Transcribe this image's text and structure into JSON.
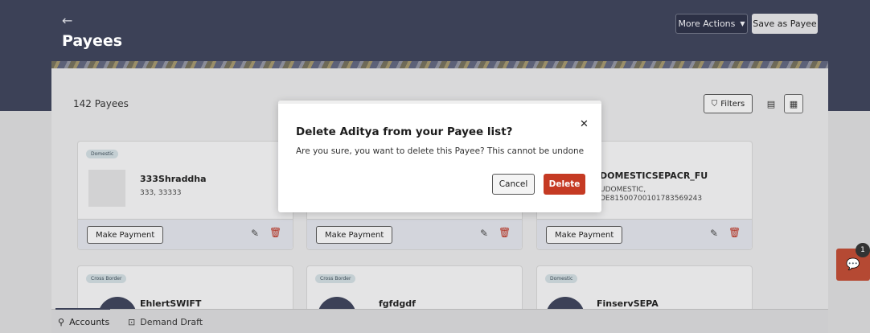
{
  "header": {
    "back_icon": "←",
    "title": "Payees",
    "more_actions_label": "More Actions",
    "more_actions_caret": "▼",
    "save_as_payee_label": "Save as Payee"
  },
  "toolbar": {
    "payee_count": "142 Payees",
    "filters_icon": "⛉",
    "filters_label": "Filters",
    "list_view_icon": "▤",
    "grid_view_icon": "▦"
  },
  "cards": [
    {
      "tag": "Domestic",
      "name": "333Shraddha",
      "line1": "333, 33333",
      "line2": "",
      "make_payment": "Make Payment"
    },
    {
      "tag": "",
      "name": "",
      "line1": "",
      "line2": "",
      "make_payment": "Make Payment"
    },
    {
      "tag": "",
      "name": "DOMESTICSEPACR_FU",
      "line1": "UDOMESTIC,",
      "line2": "DE81500700101783569243",
      "make_payment": "Make Payment"
    },
    {
      "tag": "Cross Border",
      "name": "EhlertSWIFT",
      "line1": "",
      "line2": "",
      "make_payment": ""
    },
    {
      "tag": "Cross Border",
      "name": "fgfdgdf",
      "line1": "",
      "line2": "",
      "make_payment": ""
    },
    {
      "tag": "Domestic",
      "name": "FinservSEPA",
      "line1": "",
      "line2": "",
      "make_payment": ""
    }
  ],
  "icons": {
    "edit_icon": "✎",
    "delete_icon": "🗑",
    "chat_icon": "💬",
    "close_icon": "✕",
    "accounts_icon": "⚲",
    "demand_draft_icon": "⊡"
  },
  "modal": {
    "title": "Delete Aditya from your Payee list?",
    "message": "Are you sure, you want to delete this Payee? This cannot be undone",
    "cancel_label": "Cancel",
    "delete_label": "Delete"
  },
  "bottom_nav": {
    "accounts_label": "Accounts",
    "demand_draft_label": "Demand Draft"
  },
  "chat": {
    "badge_count": "1"
  },
  "colors": {
    "header_bg": "#3c4157",
    "delete_button": "#c53a23",
    "chat_button": "#b54933"
  }
}
